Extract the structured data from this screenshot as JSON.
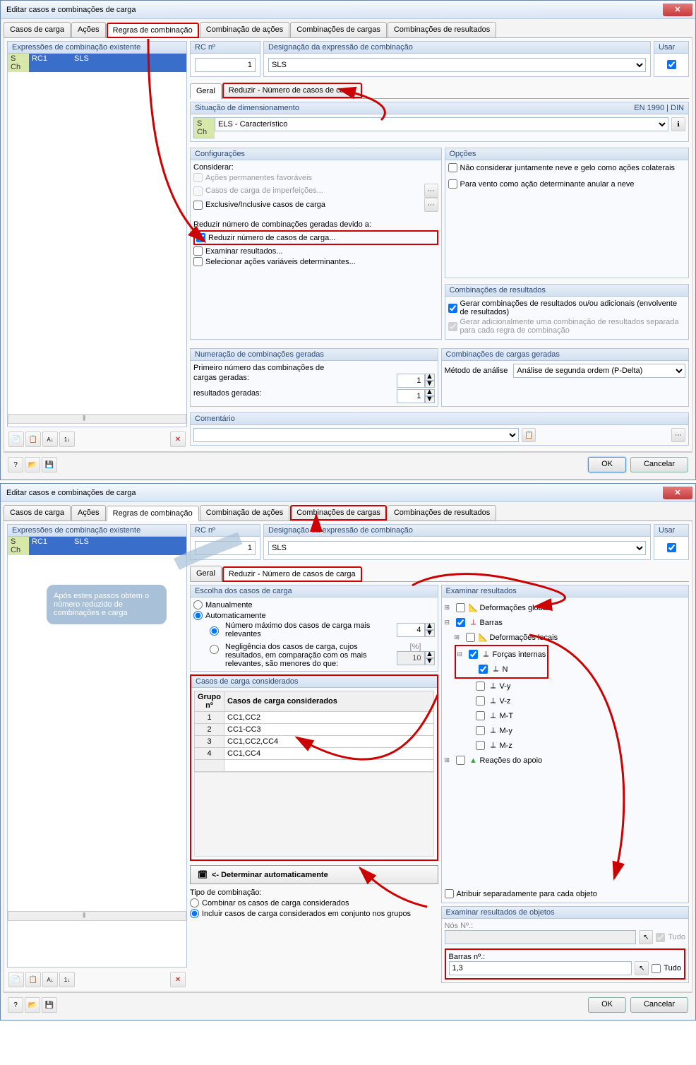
{
  "window1": {
    "title": "Editar casos e combinações de carga",
    "tabs": [
      "Casos de carga",
      "Ações",
      "Regras de combinação",
      "Combinação de ações",
      "Combinações de cargas",
      "Combinações de resultados"
    ],
    "active_tab": 2,
    "highlight_tab": 2,
    "left": {
      "header": "Expressões de combinação existente",
      "row": {
        "sch": "S Ch",
        "rc": "RC1",
        "name": "SLS"
      }
    },
    "rc_no": {
      "label": "RC nº",
      "value": "1"
    },
    "designation": {
      "label": "Designação da expressão de combinação",
      "value": "SLS"
    },
    "use": {
      "label": "Usar",
      "checked": true
    },
    "inner_tabs": [
      "Geral",
      "Reduzir - Número de casos de carga"
    ],
    "inner_active": 0,
    "inner_highlight": 1,
    "design_sit": {
      "label": "Situação de dimensionamento",
      "norm": "EN 1990 | DIN",
      "tag": "S Ch",
      "value": "ELS - Característico"
    },
    "config": {
      "header": "Configurações",
      "consider_label": "Considerar:",
      "opt1": "Ações permanentes favoráveis",
      "opt2": "Casos de carga de imperfeições...",
      "opt3": "Exclusive/Inclusive casos de carga",
      "reduce_label": "Reduzir número de combinações geradas devido a:",
      "opt4": "Reduzir número de casos de carga...",
      "opt5": "Examinar resultados...",
      "opt6": "Selecionar ações variáveis determinantes..."
    },
    "options": {
      "header": "Opções",
      "opt1": "Não considerar juntamente neve e gelo como ações colaterais",
      "opt2": "Para vento como ação determinante anular a neve"
    },
    "result_combo": {
      "header": "Combinações de resultados",
      "opt1": "Gerar combinações de resultados ou/ou adicionais (envolvente de resultados)",
      "opt2": "Gerar adicionalmente uma combinação de resultados separada para cada regra de combinação"
    },
    "numbering": {
      "header": "Numeração de combinações geradas",
      "label": "Primeiro número das combinações de",
      "row1": "cargas geradas:",
      "row2": "resultados geradas:",
      "v1": "1",
      "v2": "1"
    },
    "generated": {
      "header": "Combinações de cargas geradas",
      "label": "Método de análise",
      "value": "Análise de segunda ordem (P-Delta)"
    },
    "comment": {
      "header": "Comentário"
    },
    "ok": "OK",
    "cancel": "Cancelar"
  },
  "window2": {
    "title": "Editar casos e combinações de carga",
    "tabs": [
      "Casos de carga",
      "Ações",
      "Regras de combinação",
      "Combinação de ações",
      "Combinações de cargas",
      "Combinações de resultados"
    ],
    "active_tab": 2,
    "highlight_tab": 4,
    "left": {
      "header": "Expressões de combinação existente",
      "row": {
        "sch": "S Ch",
        "rc": "RC1",
        "name": "SLS"
      }
    },
    "callout": "Após estes passos obtem o número reduzido de combinações e carga",
    "rc_no": {
      "label": "RC nº",
      "value": "1"
    },
    "designation": {
      "label": "Designação da expressão de combinação",
      "value": "SLS"
    },
    "use": {
      "label": "Usar",
      "checked": true
    },
    "inner_tabs": [
      "Geral",
      "Reduzir - Número de casos de carga"
    ],
    "inner_active": 1,
    "choice": {
      "header": "Escolha dos casos de carga",
      "opt_manual": "Manualmente",
      "opt_auto": "Automaticamente",
      "sub1": "Número máximo dos casos de carga mais relevantes",
      "sub1_val": "4",
      "sub2": "Negligência dos casos de carga, cujos resultados, em comparação com os mais relevantes, são menores do que:",
      "sub2_unit": "[%]",
      "sub2_val": "10"
    },
    "considered": {
      "header": "Casos de carga considerados",
      "col1": "Grupo nº",
      "col2": "Casos de carga considerados",
      "rows": [
        {
          "n": "1",
          "v": "CC1,CC2"
        },
        {
          "n": "2",
          "v": "CC1-CC3"
        },
        {
          "n": "3",
          "v": "CC1,CC2,CC4"
        },
        {
          "n": "4",
          "v": "CC1,CC4"
        }
      ]
    },
    "determine": "<- Determinar automaticamente",
    "combo_type": {
      "label": "Tipo de combinação:",
      "opt1": "Combinar os casos de carga considerados",
      "opt2": "Incluir casos de carga considerados em conjunto nos grupos"
    },
    "examine": {
      "header": "Examinar resultados",
      "items": {
        "global": "Deformações globais",
        "bars": "Barras",
        "local_def": "Deformações locais",
        "internal": "Forças internas",
        "N": "N",
        "Vy": "V-y",
        "Vz": "V-z",
        "MT": "M-T",
        "My": "M-y",
        "Mz": "M-z",
        "support": "Reações do apoio"
      },
      "attr_sep": "Atribuir separadamente para cada objeto"
    },
    "examine_obj": {
      "header": "Examinar resultados de objetos",
      "nodes_label": "Nós Nº.:",
      "all": "Tudo",
      "bars_label": "Barras nº.:",
      "bars_val": "1,3"
    },
    "ok": "OK",
    "cancel": "Cancelar"
  }
}
